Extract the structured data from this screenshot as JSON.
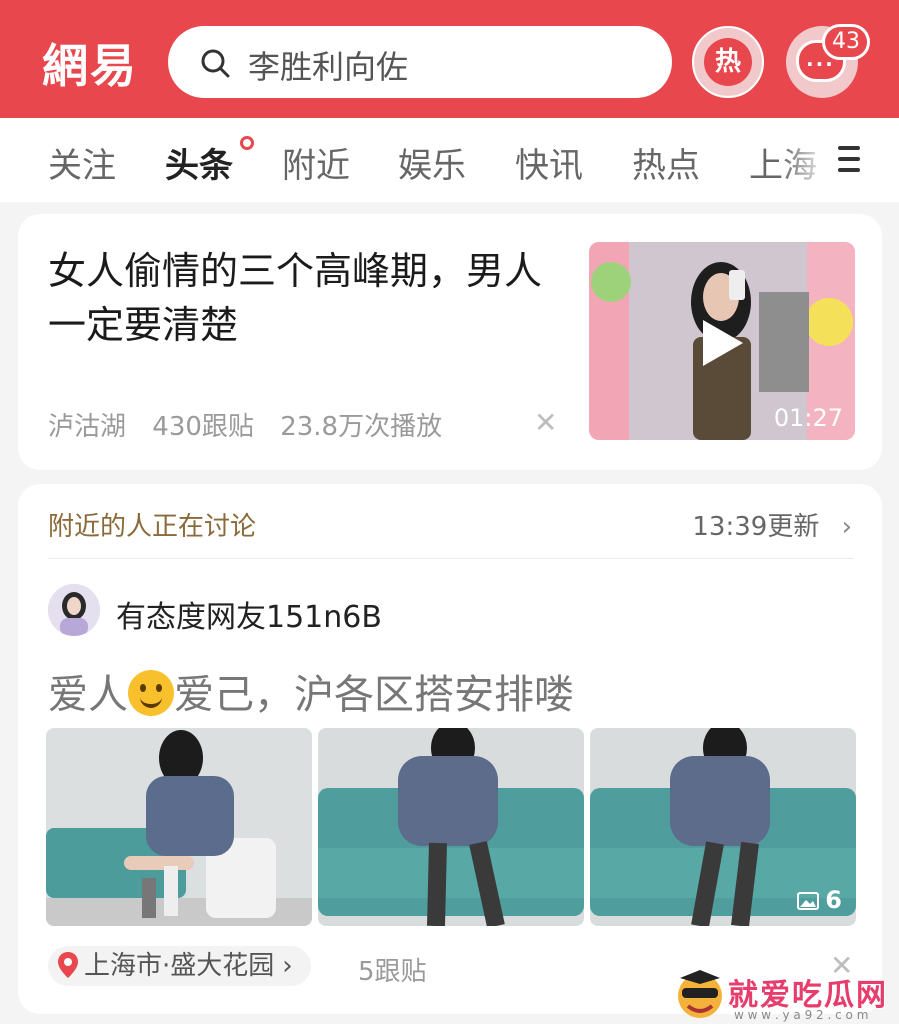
{
  "header": {
    "logo": "網易",
    "search_query": "李胜利向佐",
    "hot_label": "热",
    "message_badge": "43"
  },
  "tabs": [
    "关注",
    "头条",
    "附近",
    "娱乐",
    "快讯",
    "热点",
    "上海"
  ],
  "active_tab": "头条",
  "article": {
    "title": "女人偷情的三个高峰期，男人一定要清楚",
    "source": "泸沽湖",
    "comments": "430跟贴",
    "plays": "23.8万次播放",
    "duration": "01:27"
  },
  "nearby": {
    "section_title": "附近的人正在讨论",
    "update_time": "13:39更新",
    "username": "有态度网友151n6B",
    "post_before_emoji": "爱人",
    "post_after_emoji": "爱己，沪各区搭安排喽",
    "photo_count": "6",
    "location": "上海市·盛大花园",
    "replies": "5跟贴"
  },
  "watermark": {
    "text": "就爱吃瓜网",
    "url": "w w w . y a 9 2 . c o m"
  },
  "colors": {
    "brand_red": "#e8474d",
    "section_gold": "#8a6a3a"
  }
}
